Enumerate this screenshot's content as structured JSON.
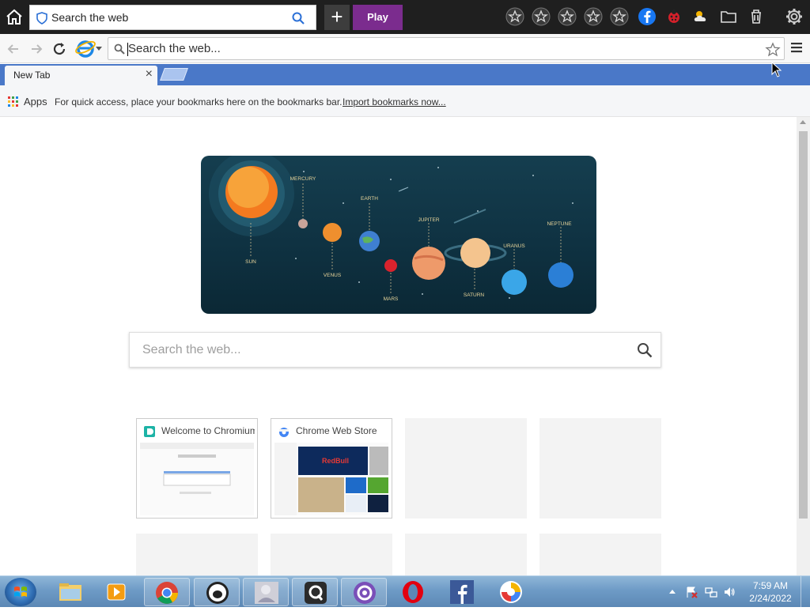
{
  "topbar": {
    "search_label": "Search the web",
    "play_label": "Play",
    "plus_label": "+"
  },
  "addressbar": {
    "placeholder": "Search the web..."
  },
  "tab": {
    "title": "New Tab",
    "close": "×"
  },
  "bookmarks": {
    "apps_label": "Apps",
    "hint": "For quick access, place your bookmarks here on the bookmarks bar.",
    "import_link": "Import bookmarks now..."
  },
  "banner": {
    "planets": [
      "SUN",
      "MERCURY",
      "VENUS",
      "EARTH",
      "MARS",
      "JUPITER",
      "SATURN",
      "URANUS",
      "NEPTUNE"
    ]
  },
  "main_search": {
    "placeholder": "Search the web..."
  },
  "tiles": [
    {
      "title": "Welcome to Chromium"
    },
    {
      "title": "Chrome Web Store"
    }
  ],
  "taskbar": {
    "time": "7:59 AM",
    "date": "2/24/2022"
  },
  "colors": {
    "topbar_bg": "#1f1f1f",
    "play_button": "#7b2c8e",
    "tabstrip": "#4a78c8",
    "banner_bg": "#0f3242"
  }
}
